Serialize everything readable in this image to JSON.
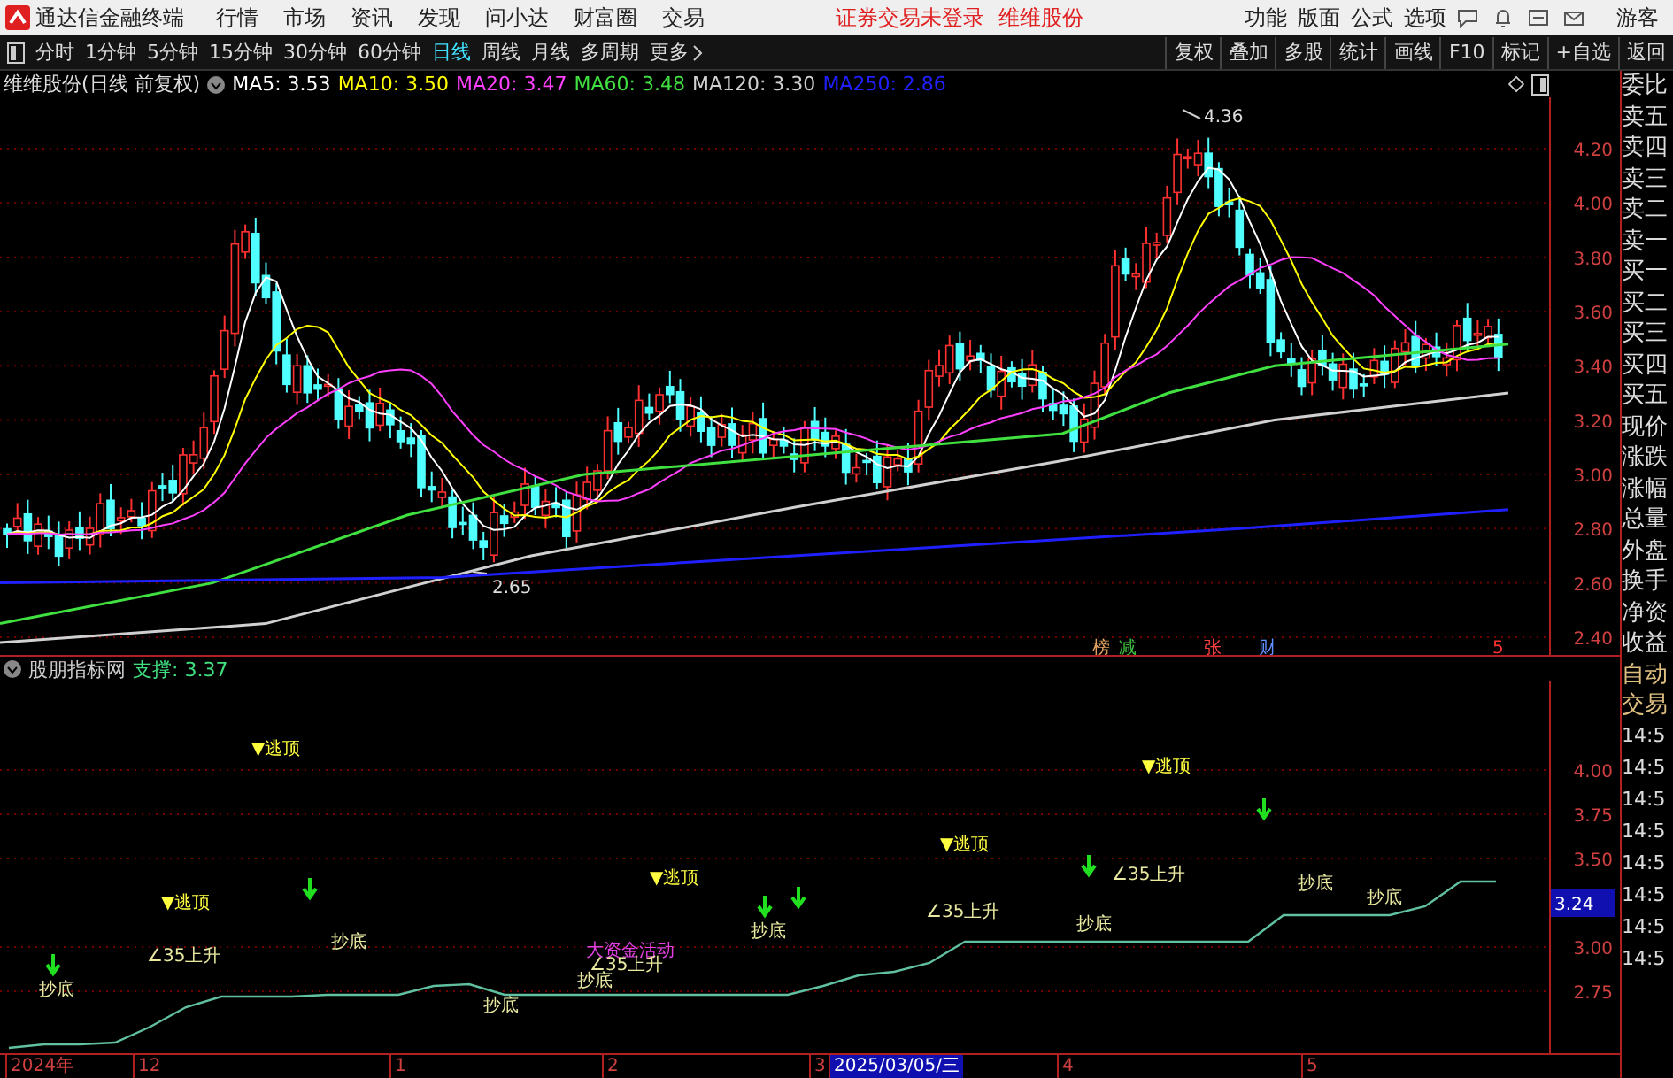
{
  "title_bar": {
    "app_name": "通达信金融终端",
    "menu": [
      "行情",
      "市场",
      "资讯",
      "发现",
      "问小达",
      "财富圈",
      "交易"
    ],
    "notices": [
      "证券交易未登录",
      "维维股份"
    ],
    "tools": [
      "功能",
      "版面",
      "公式",
      "选项"
    ],
    "user": "游客"
  },
  "period_bar": {
    "periods": [
      {
        "label": "分时",
        "selected": false
      },
      {
        "label": "1分钟",
        "selected": false
      },
      {
        "label": "5分钟",
        "selected": false
      },
      {
        "label": "15分钟",
        "selected": false
      },
      {
        "label": "30分钟",
        "selected": false
      },
      {
        "label": "60分钟",
        "selected": false
      },
      {
        "label": "日线",
        "selected": true
      },
      {
        "label": "周线",
        "selected": false
      },
      {
        "label": "月线",
        "selected": false
      },
      {
        "label": "多周期",
        "selected": false
      }
    ],
    "more": "更多",
    "buttons": [
      "复权",
      "叠加",
      "多股",
      "统计",
      "画线",
      "F10",
      "标记",
      "+自选",
      "返回"
    ]
  },
  "main_chart": {
    "title": "维维股份(日线 前复权)",
    "moving_averages": [
      {
        "label": "MA5: 3.53",
        "color": "#ffffff"
      },
      {
        "label": "MA10: 3.50",
        "color": "#ffff00"
      },
      {
        "label": "MA20: 3.47",
        "color": "#ff40ff"
      },
      {
        "label": "MA60: 3.48",
        "color": "#40e040"
      },
      {
        "label": "MA120: 3.30",
        "color": "#d0d0d0"
      },
      {
        "label": "MA250: 2.86",
        "color": "#2020ff"
      }
    ],
    "y_ticks": [
      "4.20",
      "4.00",
      "3.80",
      "3.60",
      "3.40",
      "3.20",
      "3.00",
      "2.80",
      "2.60",
      "2.40"
    ],
    "high_label": "4.36",
    "low_label": "2.65",
    "event_tags": [
      {
        "label": "榜",
        "color": "#e0a060"
      },
      {
        "label": "减",
        "color": "#40c040"
      },
      {
        "label": "张",
        "color": "#ff4040"
      },
      {
        "label": "财",
        "color": "#6090ff"
      }
    ],
    "corner_mark": "5"
  },
  "indicator": {
    "name": "股朋指标网",
    "support": "支撑: 3.37",
    "current_value": "3.24",
    "chart_data": {
      "type": "line",
      "grid": true,
      "ylim": [
        2.4,
        4.5
      ],
      "yticks": [
        {
          "value": 4,
          "label": "4.00"
        },
        {
          "value": 3.75,
          "label": "3.75"
        },
        {
          "value": 3.5,
          "label": "3.50"
        },
        {
          "value": 3,
          "label": "3.00"
        },
        {
          "value": 2.75,
          "label": "2.75"
        }
      ],
      "series": [
        {
          "color": "#60c0a0",
          "values": [
            2.43,
            2.45,
            2.45,
            2.46,
            2.55,
            2.66,
            2.72,
            2.72,
            2.72,
            2.73,
            2.73,
            2.73,
            2.78,
            2.79,
            2.73,
            2.73,
            2.73,
            2.73,
            2.73,
            2.73,
            2.73,
            2.73,
            2.73,
            2.78,
            2.84,
            2.86,
            2.91,
            3.03,
            3.03,
            3.03,
            3.03,
            3.03,
            3.03,
            3.03,
            3.03,
            3.03,
            3.18,
            3.18,
            3.18,
            3.18,
            3.23,
            3.37,
            3.37
          ]
        }
      ]
    },
    "signals": [
      {
        "kind": "arrow"
      },
      {
        "kind": "bottom",
        "label": "抄底"
      },
      {
        "kind": "rise",
        "label": "∠35上升"
      },
      {
        "kind": "top",
        "label": "▼逃顶"
      },
      {
        "kind": "top",
        "label": "▼逃顶"
      },
      {
        "kind": "arrow"
      },
      {
        "kind": "bottom",
        "label": "抄底"
      },
      {
        "kind": "bottom",
        "label": "抄底"
      },
      {
        "kind": "money",
        "label": "大资金活动"
      },
      {
        "kind": "rise",
        "label": "∠35上升"
      },
      {
        "kind": "bottom",
        "label": "抄底"
      },
      {
        "kind": "top",
        "label": "▼逃顶"
      },
      {
        "kind": "arrow"
      },
      {
        "kind": "bottom",
        "label": "抄底"
      },
      {
        "kind": "arrow"
      },
      {
        "kind": "rise",
        "label": "∠35上升"
      },
      {
        "kind": "top",
        "label": "▼逃顶"
      },
      {
        "kind": "bottom",
        "label": "抄底"
      },
      {
        "kind": "arrow"
      },
      {
        "kind": "rise",
        "label": "∠35上升"
      },
      {
        "kind": "top",
        "label": "▼逃顶"
      },
      {
        "kind": "arrow"
      },
      {
        "kind": "bottom",
        "label": "抄底"
      },
      {
        "kind": "bottom",
        "label": "抄底"
      }
    ]
  },
  "time_axis": [
    {
      "label": "2024年",
      "selected": false
    },
    {
      "label": "12",
      "selected": false
    },
    {
      "label": "1",
      "selected": false
    },
    {
      "label": "2",
      "selected": false
    },
    {
      "label": "3",
      "selected": false
    },
    {
      "label": "2025/03/05/三",
      "selected": true
    },
    {
      "label": "4",
      "selected": false
    },
    {
      "label": "5",
      "selected": false
    }
  ],
  "side_panel": {
    "quote_labels": [
      "委比",
      "卖五",
      "卖四",
      "卖三",
      "卖二",
      "卖一",
      "买一",
      "买二",
      "买三",
      "买四",
      "买五",
      "现价",
      "涨跌",
      "涨幅",
      "总量",
      "外盘",
      "换手",
      "净资",
      "收益"
    ],
    "trade_labels": [
      "自动",
      "交易"
    ],
    "times": [
      "14:5",
      "14:5",
      "14:5",
      "14:5",
      "14:5",
      "14:5",
      "14:5",
      "14:5"
    ]
  }
}
